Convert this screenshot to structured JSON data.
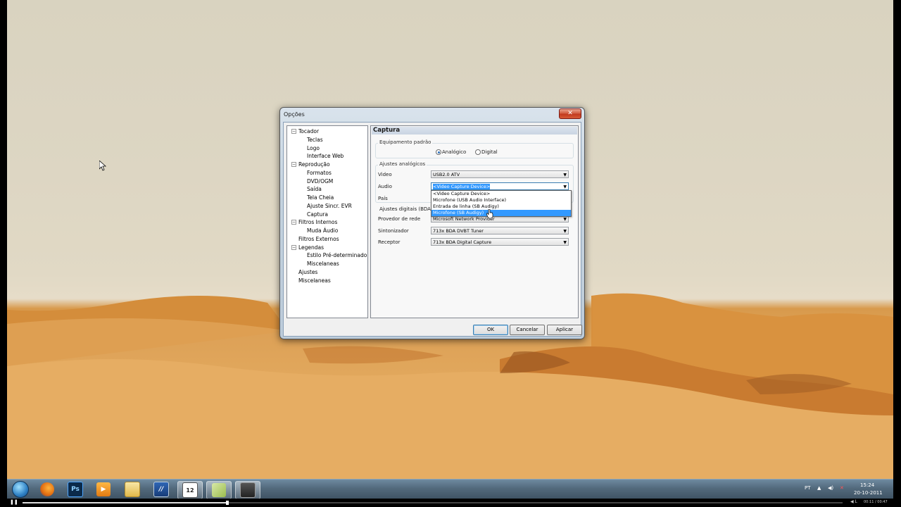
{
  "window": {
    "title": "Opções",
    "close_glyph": "✕"
  },
  "tree": [
    {
      "label": "Tocador",
      "level": 0,
      "expander": "−"
    },
    {
      "label": "Teclas",
      "level": 1
    },
    {
      "label": "Logo",
      "level": 1
    },
    {
      "label": "Interface Web",
      "level": 1
    },
    {
      "label": "Reprodução",
      "level": 0,
      "expander": "−"
    },
    {
      "label": "Formatos",
      "level": 1
    },
    {
      "label": "DVD/OGM",
      "level": 1
    },
    {
      "label": "Saída",
      "level": 1
    },
    {
      "label": "Tela Cheia",
      "level": 1
    },
    {
      "label": "Ajuste Sincr. EVR",
      "level": 1
    },
    {
      "label": "Captura",
      "level": 1
    },
    {
      "label": "Filtros Internos",
      "level": 0,
      "expander": "−"
    },
    {
      "label": "Muda Áudio",
      "level": 1
    },
    {
      "label": "Filtros Externos",
      "level": 0
    },
    {
      "label": "Legendas",
      "level": 0,
      "expander": "−"
    },
    {
      "label": "Estilo Pré-determinado",
      "level": 1
    },
    {
      "label": "Miscelaneas",
      "level": 1
    },
    {
      "label": "Ajustes",
      "level": 0
    },
    {
      "label": "Miscelaneas",
      "level": 0
    }
  ],
  "panel": {
    "title": "Captura",
    "default_group": "Equipamento padrão",
    "radio_analog": "Analógico",
    "radio_digital": "Digital",
    "analog_group": "Ajustes analógicos",
    "video_label": "Video",
    "video_value": "USB2.0 ATV",
    "audio_label": "Audio",
    "audio_value": "<Video Capture Device>",
    "country_label": "País",
    "digital_group": "Ajustes digitais (BDA)",
    "network_label": "Provedor de rede",
    "network_value": "Microsoft Network Provider",
    "tuner_label": "Sintonizador",
    "tuner_value": "713x BDA DVBT Tuner",
    "receiver_label": "Receptor",
    "receiver_value": "713x BDA Digital Capture",
    "dropdown_arrow": "▼"
  },
  "dropdown": [
    "<Video Capture Device>",
    "Microfone (USB Audio Interface)",
    "Entrada de linha (SB Audigy)",
    "Microfone (SB Audigy)"
  ],
  "dropdown_selected_index": 3,
  "buttons": {
    "ok": "OK",
    "cancel": "Cancelar",
    "apply": "Aplicar"
  },
  "taskbar": {
    "apps": [
      {
        "icon": "start-orb-icon"
      },
      {
        "icon": "firefox-icon"
      },
      {
        "icon": "photoshop-icon",
        "text": "Ps"
      },
      {
        "icon": "media-player-icon"
      },
      {
        "icon": "folder-icon"
      },
      {
        "icon": "app-icon"
      },
      {
        "icon": "calendar-icon",
        "text": "12"
      },
      {
        "icon": "notepad-icon"
      },
      {
        "icon": "camera-icon"
      }
    ],
    "lang": "PT",
    "time": "15:24",
    "date": "20-10-2011"
  },
  "player": {
    "time": "00:11 / 00:47",
    "progress": 0.25
  }
}
